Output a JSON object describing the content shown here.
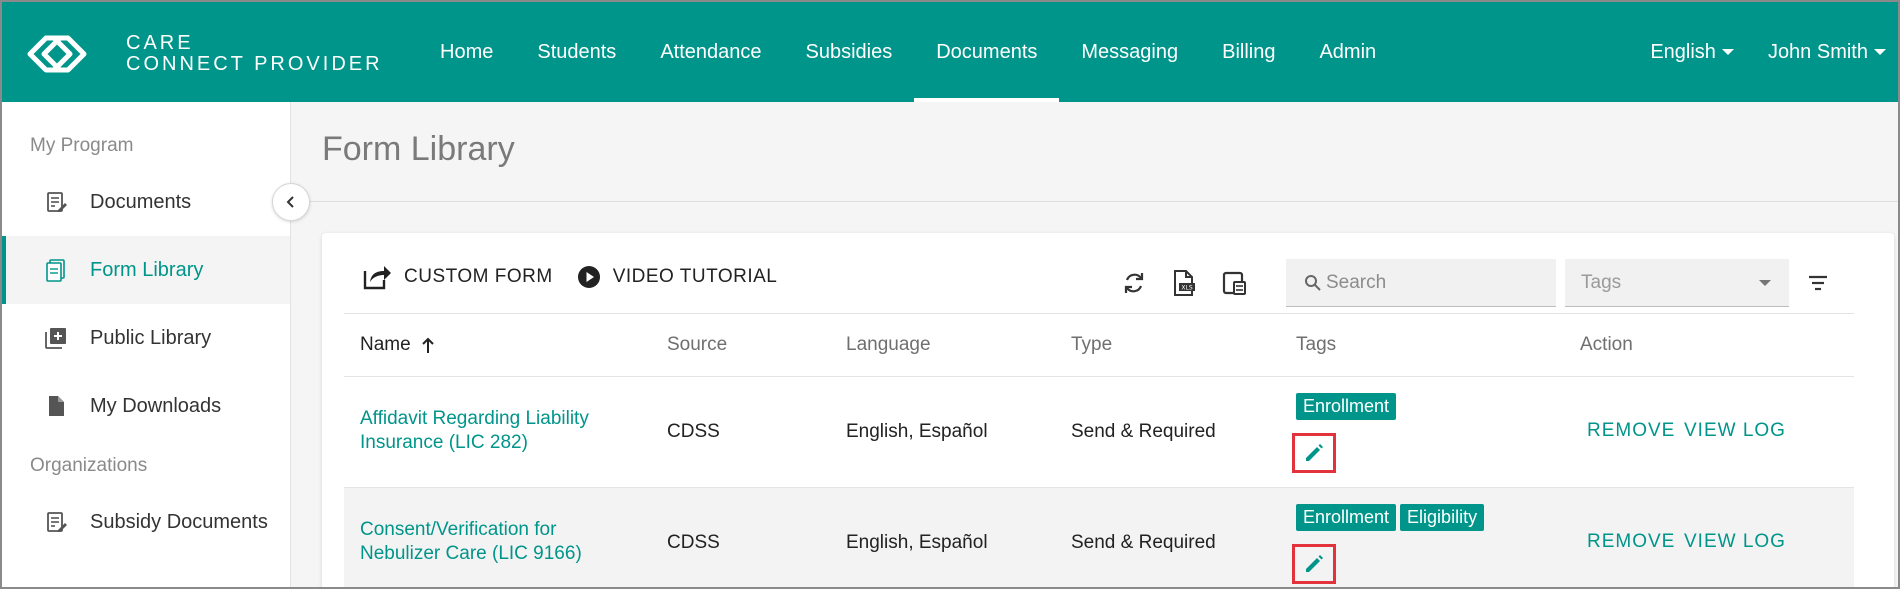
{
  "brand": {
    "line1": "CARE",
    "line2": "CONNECT PROVIDER"
  },
  "nav": [
    {
      "label": "Home"
    },
    {
      "label": "Students"
    },
    {
      "label": "Attendance"
    },
    {
      "label": "Subsidies"
    },
    {
      "label": "Documents"
    },
    {
      "label": "Messaging"
    },
    {
      "label": "Billing"
    },
    {
      "label": "Admin"
    }
  ],
  "nav_active": "Documents",
  "language_label": "English",
  "user_label": "John Smith",
  "sidebar": {
    "section1": "My Program",
    "items": [
      {
        "label": "Documents"
      },
      {
        "label": "Form Library"
      },
      {
        "label": "Public Library"
      },
      {
        "label": "My Downloads"
      }
    ],
    "section2": "Organizations",
    "items2": [
      {
        "label": "Subsidy Documents"
      }
    ]
  },
  "page": {
    "title": "Form Library"
  },
  "toolbar": {
    "custom_form": "CUSTOM FORM",
    "video_tutorial": "VIDEO TUTORIAL",
    "search_placeholder": "Search",
    "tags_placeholder": "Tags"
  },
  "table": {
    "headers": {
      "name": "Name",
      "source": "Source",
      "language": "Language",
      "type": "Type",
      "tags": "Tags",
      "action": "Action"
    },
    "rows": [
      {
        "name_line1": "Affidavit Regarding Liability",
        "name_line2": "Insurance (LIC 282)",
        "source": "CDSS",
        "language": "English, Español",
        "type": "Send & Required",
        "tags": [
          "Enrollment"
        ],
        "remove": "REMOVE",
        "view_log": "VIEW LOG"
      },
      {
        "name_line1": "Consent/Verification for",
        "name_line2": "Nebulizer Care (LIC 9166)",
        "source": "CDSS",
        "language": "English, Español",
        "type": "Send & Required",
        "tags": [
          "Enrollment",
          "Eligibility"
        ],
        "remove": "REMOVE",
        "view_log": "VIEW LOG"
      }
    ]
  },
  "colors": {
    "primary": "#00958a",
    "highlight": "#e2333d"
  }
}
